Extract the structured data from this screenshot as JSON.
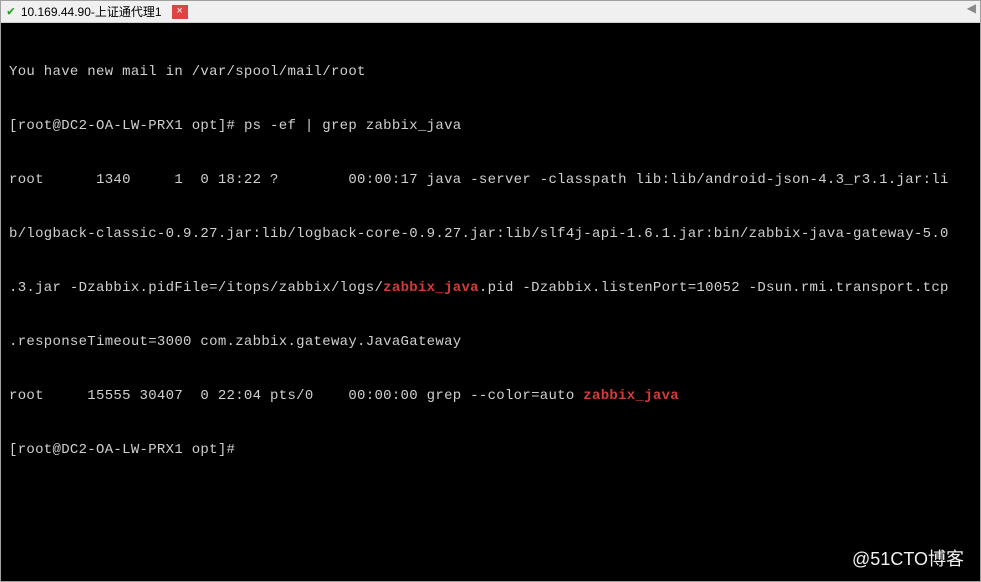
{
  "titlebar": {
    "check_glyph": "✔",
    "title": "10.169.44.90-上证通代理1",
    "close_glyph": "×",
    "scroll_glyph": "◀"
  },
  "terminal": {
    "line1": "You have new mail in /var/spool/mail/root",
    "line2_pre": "[root@DC2-OA-LW-PRX1 opt]# ",
    "line2_cmd": "ps -ef | grep zabbix_java",
    "line3": "root      1340     1  0 18:22 ?        00:00:17 java -server -classpath lib:lib/android-json-4.3_r3.1.jar:li",
    "line4_a": "b/logback-classic-0.9.27.jar:lib/logback-core-0.9.27.jar:lib/slf4j-api-1.6.1.jar:bin/zabbix-java-gateway-5.0",
    "line5_a": ".3.jar -Dzabbix.pidFile=/itops/zabbix/logs/",
    "line5_hl": "zabbix_java",
    "line5_b": ".pid -Dzabbix.listenPort=10052 -Dsun.rmi.transport.tcp",
    "line6": ".responseTimeout=3000 com.zabbix.gateway.JavaGateway",
    "line7_a": "root     15555 30407  0 22:04 pts/0    00:00:00 grep --color=auto ",
    "line7_hl": "zabbix_java",
    "line8": "[root@DC2-OA-LW-PRX1 opt]# "
  },
  "watermark": "@51CTO博客"
}
